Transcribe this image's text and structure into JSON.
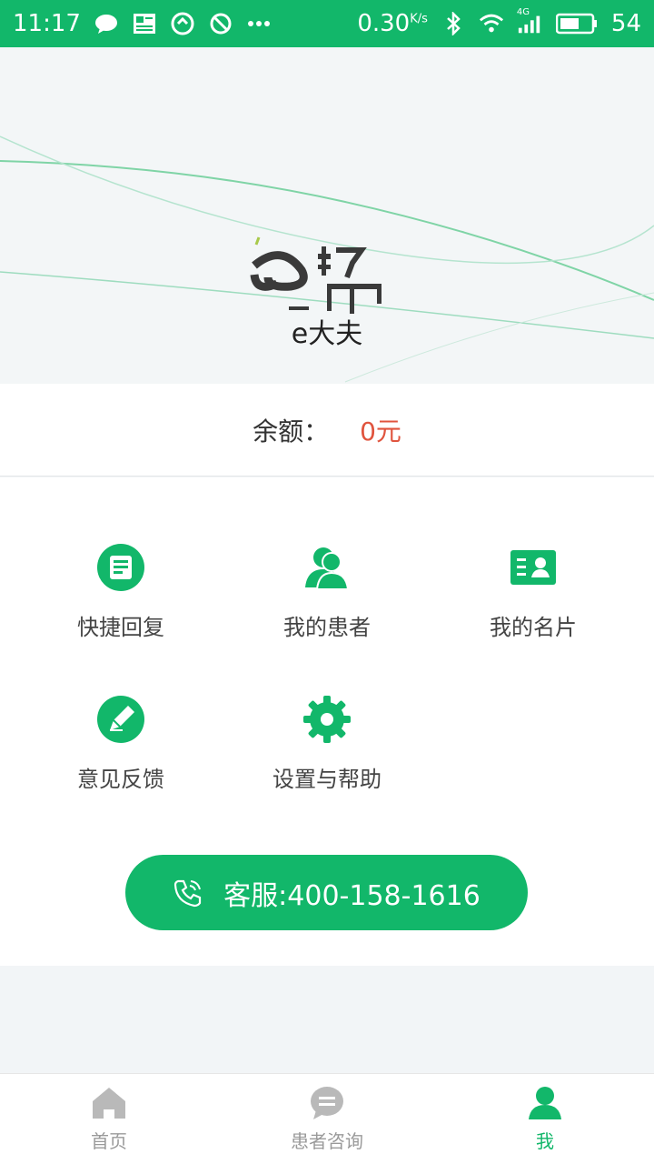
{
  "status_bar": {
    "time": "11:17",
    "speed": "0.30",
    "speed_unit": "K/s",
    "network": "4G",
    "battery": "54"
  },
  "header": {
    "brand_text": "e帮",
    "username": "e大夫"
  },
  "balance": {
    "label": "余额：",
    "value": "0元"
  },
  "grid": {
    "items": [
      {
        "label": "快捷回复",
        "icon": "quick-reply-icon"
      },
      {
        "label": "我的患者",
        "icon": "patients-icon"
      },
      {
        "label": "我的名片",
        "icon": "business-card-icon"
      },
      {
        "label": "意见反馈",
        "icon": "feedback-icon"
      },
      {
        "label": "设置与帮助",
        "icon": "settings-icon"
      }
    ]
  },
  "service": {
    "label": "客服:400-158-1616"
  },
  "bottom_nav": {
    "items": [
      {
        "label": "首页",
        "icon": "home-icon"
      },
      {
        "label": "患者咨询",
        "icon": "consult-icon"
      },
      {
        "label": "我",
        "icon": "profile-icon"
      }
    ],
    "active_index": 2
  },
  "colors": {
    "accent": "#12b76a",
    "balance_value": "#e0543e",
    "nav_inactive": "#9a9a9a"
  }
}
